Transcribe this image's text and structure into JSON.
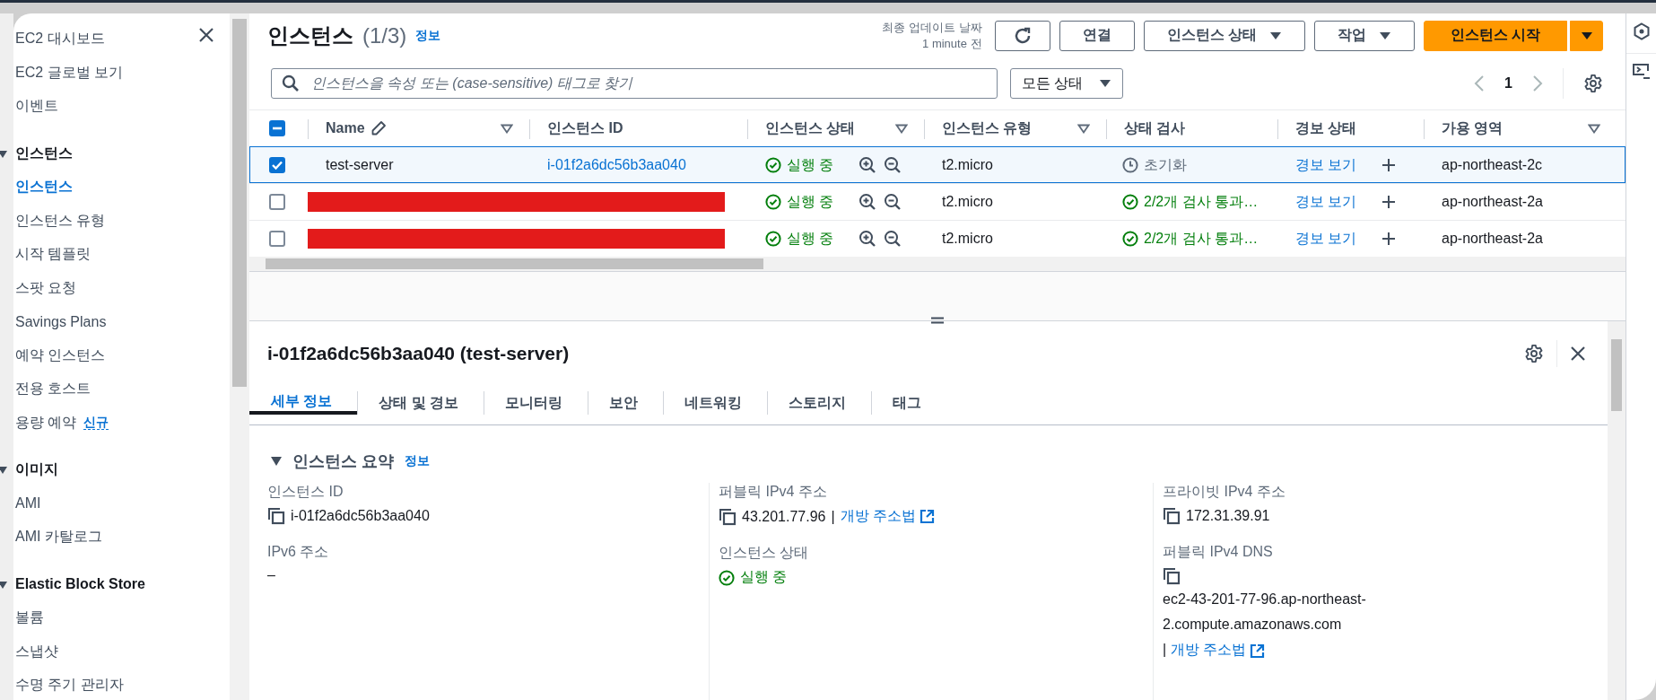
{
  "sidebar": {
    "items": [
      {
        "kind": "link",
        "label": "EC2 대시보드",
        "selected": false
      },
      {
        "kind": "link",
        "label": "EC2 글로벌 보기",
        "selected": false
      },
      {
        "kind": "link",
        "label": "이벤트",
        "selected": false
      },
      {
        "kind": "section",
        "label": "인스턴스",
        "expanded": true
      },
      {
        "kind": "link",
        "label": "인스턴스",
        "selected": true
      },
      {
        "kind": "link",
        "label": "인스턴스 유형",
        "selected": false
      },
      {
        "kind": "link",
        "label": "시작 템플릿",
        "selected": false
      },
      {
        "kind": "link",
        "label": "스팟 요청",
        "selected": false
      },
      {
        "kind": "link",
        "label": "Savings Plans",
        "selected": false
      },
      {
        "kind": "link",
        "label": "예약 인스턴스",
        "selected": false
      },
      {
        "kind": "link",
        "label": "전용 호스트",
        "selected": false
      },
      {
        "kind": "link",
        "label": "용량 예약",
        "badge": "신규",
        "selected": false
      },
      {
        "kind": "section",
        "label": "이미지",
        "expanded": true
      },
      {
        "kind": "link",
        "label": "AMI",
        "selected": false
      },
      {
        "kind": "link",
        "label": "AMI 카탈로그",
        "selected": false
      },
      {
        "kind": "section",
        "label": "Elastic Block Store",
        "expanded": true
      },
      {
        "kind": "link",
        "label": "볼륨",
        "selected": false
      },
      {
        "kind": "link",
        "label": "스냅샷",
        "selected": false
      },
      {
        "kind": "link",
        "label": "수명 주기 관리자",
        "selected": false
      }
    ]
  },
  "header": {
    "title": "인스턴스",
    "count": "(1/3)",
    "info": "정보",
    "updated_label": "최종 업데이트 날짜",
    "updated_value": "1 minute 전",
    "buttons": [
      {
        "kind": "refresh"
      },
      {
        "kind": "plain",
        "label": "연결"
      },
      {
        "kind": "dropdown",
        "label": "인스턴스 상태"
      },
      {
        "kind": "dropdown",
        "label": "작업"
      },
      {
        "kind": "primary",
        "label": "인스턴스 시작"
      }
    ],
    "search": {
      "placeholder": "인스턴스을 속성 또는 (case-sensitive) 태그로 찾기"
    },
    "filter": "모든 상태",
    "page": "1"
  },
  "table": {
    "header_checkbox": {
      "checked": true,
      "indeterminate": true
    },
    "columns": [
      {
        "label": "Name",
        "editable": true,
        "filter": true
      },
      {
        "label": "인스턴스 ID",
        "filter": false
      },
      {
        "label": "인스턴스 상태",
        "filter": true
      },
      {
        "label": "인스턴스 유형",
        "filter": true
      },
      {
        "label": "상태 검사",
        "filter": false
      },
      {
        "label": "경보 상태",
        "filter": false
      },
      {
        "label": "가용 영역",
        "filter": true
      }
    ],
    "rows": [
      {
        "selected": true,
        "redacted": false,
        "name": "test-server",
        "id": "i-01f2a6dc56b3aa040",
        "state": "실행 중",
        "type": "t2.micro",
        "check": {
          "kind": "initializing",
          "text": "초기화"
        },
        "alarm": "경보 보기",
        "zone": "ap-northeast-2c"
      },
      {
        "selected": false,
        "redacted": true,
        "state": "실행 중",
        "type": "t2.micro",
        "check": {
          "kind": "passed",
          "text": "2/2개 검사 통과…"
        },
        "alarm": "경보 보기",
        "zone": "ap-northeast-2a"
      },
      {
        "selected": false,
        "redacted": true,
        "state": "실행 중",
        "type": "t2.micro",
        "check": {
          "kind": "passed",
          "text": "2/2개 검사 통과…"
        },
        "alarm": "경보 보기",
        "zone": "ap-northeast-2a"
      }
    ]
  },
  "detail": {
    "title": "i-01f2a6dc56b3aa040 (test-server)",
    "tabs": [
      {
        "label": "세부 정보",
        "selected": true
      },
      {
        "label": "상태 및 경보",
        "selected": false
      },
      {
        "label": "모니터링",
        "selected": false
      },
      {
        "label": "보안",
        "selected": false
      },
      {
        "label": "네트워킹",
        "selected": false
      },
      {
        "label": "스토리지",
        "selected": false
      },
      {
        "label": "태그",
        "selected": false
      }
    ],
    "summary": {
      "title": "인스턴스 요약",
      "info": "정보",
      "expanded": true,
      "columns": [
        [
          {
            "kind": "copy",
            "label": "인스턴스 ID",
            "value": "i-01f2a6dc56b3aa040"
          },
          {
            "kind": "text",
            "label": "IPv6 주소",
            "value": "–"
          }
        ],
        [
          {
            "kind": "copy",
            "label": "퍼블릭 IPv4 주소",
            "value": "43.201.77.96",
            "separator": "|",
            "link": "개방 주소법"
          },
          {
            "kind": "status",
            "label": "인스턴스 상태",
            "value": "실행 중"
          }
        ],
        [
          {
            "kind": "copy",
            "label": "프라이빗 IPv4 주소",
            "value": "172.31.39.91"
          },
          {
            "kind": "stacked",
            "label": "퍼블릭 IPv4 DNS",
            "value": "ec2-43-201-77-96.ap-northeast-2.compute.amazonaws.com",
            "separator": "|",
            "link": "개방 주소법"
          }
        ]
      ]
    }
  }
}
